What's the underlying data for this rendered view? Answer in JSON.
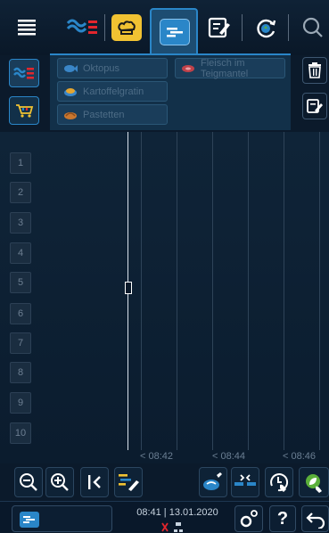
{
  "nav": {
    "icons": [
      "menu-icon",
      "hot-dishes-icon",
      "chef-hat-icon",
      "schedule-icon",
      "edit-icon",
      "cleaning-cycle-icon",
      "search-icon"
    ]
  },
  "panel": {
    "items": [
      {
        "label": "Oktopus",
        "icon": "fish-icon"
      },
      {
        "label": "Fleisch im Teigmantel",
        "icon": "meat-icon"
      },
      {
        "label": "Kartoffelgratin",
        "icon": "gratin-icon"
      },
      {
        "label": "Pastetten",
        "icon": "pastry-icon"
      }
    ]
  },
  "slots": [
    "1",
    "2",
    "3",
    "4",
    "5",
    "6",
    "7",
    "8",
    "9",
    "10"
  ],
  "timeline": {
    "labels": [
      "< 08:42",
      "< 08:44",
      "< 08:46"
    ]
  },
  "footer": {
    "clock": "08:41 | 13.01.2020"
  },
  "colors": {
    "accent_blue": "#2a86c8",
    "yellow": "#f1c232",
    "red": "#e2262d",
    "green": "#5bb03a"
  }
}
